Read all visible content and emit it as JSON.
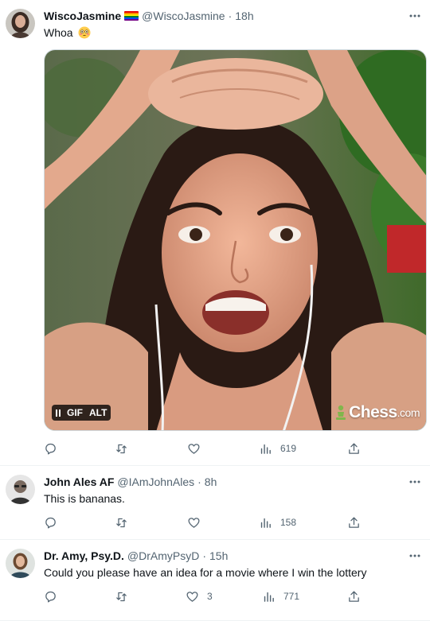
{
  "tweets": [
    {
      "name": "WiscoJasmine",
      "handle": "@WiscoJasmine",
      "time": "18h",
      "text": "Whoa",
      "emoji": "flushed-face",
      "has_flag": true,
      "media": {
        "type": "GIF",
        "controls": {
          "pause_icon": "pause-icon",
          "gif_label": "GIF",
          "alt_label": "ALT"
        },
        "watermark": {
          "main": "Chess",
          "suffix": ".com"
        }
      },
      "metrics": {
        "replies": "",
        "reposts": "",
        "likes": "",
        "views": "619"
      }
    },
    {
      "name": "John Ales AF",
      "handle": "@IAmJohnAles",
      "time": "8h",
      "text": "This is bananas.",
      "metrics": {
        "replies": "",
        "reposts": "",
        "likes": "",
        "views": "158"
      }
    },
    {
      "name": "Dr. Amy, Psy.D.",
      "handle": "@DrAmyPsyD",
      "time": "15h",
      "text": "Could you please have an idea for a movie where I win the lottery",
      "metrics": {
        "replies": "",
        "reposts": "",
        "likes": "3",
        "views": "771"
      }
    }
  ],
  "separator": "·",
  "colors": {
    "text": "#0f1419",
    "secondary": "#536471",
    "border": "#eff3f4",
    "flag": [
      "#e40303",
      "#ff8c00",
      "#ffed00",
      "#008026",
      "#004dff",
      "#750787"
    ]
  }
}
